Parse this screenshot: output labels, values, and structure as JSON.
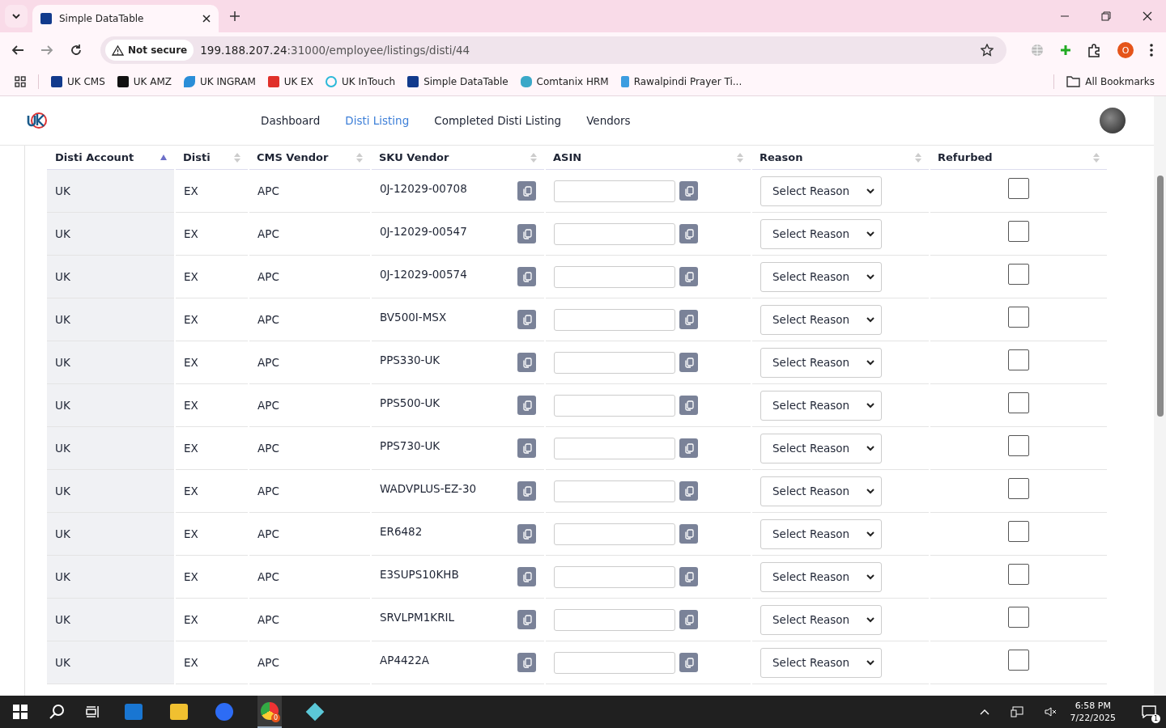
{
  "browser": {
    "tab_title": "Simple DataTable",
    "security": "Not secure",
    "url_host": "199.188.207.24",
    "url_path": ":31000/employee/listings/disti/44",
    "profile": "O",
    "bookmarks": [
      {
        "label": "UK CMS",
        "kind": "df"
      },
      {
        "label": "UK AMZ",
        "kind": "amz"
      },
      {
        "label": "UK INGRAM",
        "kind": "ingram"
      },
      {
        "label": "UK EX",
        "kind": "ex"
      },
      {
        "label": "UK InTouch",
        "kind": "intouch"
      },
      {
        "label": "Simple DataTable",
        "kind": "df"
      },
      {
        "label": "Comtanix HRM",
        "kind": "hex"
      },
      {
        "label": "Rawalpindi Prayer Ti...",
        "kind": "h"
      }
    ],
    "all_bookmarks": "All Bookmarks"
  },
  "nav": [
    {
      "label": "Dashboard",
      "selected": false
    },
    {
      "label": "Disti Listing",
      "selected": true
    },
    {
      "label": "Completed Disti Listing",
      "selected": false
    },
    {
      "label": "Vendors",
      "selected": false
    }
  ],
  "table": {
    "columns": [
      {
        "label": "Disti Account",
        "sorted": true
      },
      {
        "label": "Disti",
        "sorted": false
      },
      {
        "label": "CMS Vendor",
        "sorted": false
      },
      {
        "label": "SKU Vendor",
        "sorted": false
      },
      {
        "label": "ASIN",
        "sorted": false
      },
      {
        "label": "Reason",
        "sorted": false
      },
      {
        "label": "Refurbed",
        "sorted": false
      }
    ],
    "rows": [
      {
        "account": "UK",
        "disti": "EX",
        "cms_vendor": "APC",
        "sku_vendor": "0J-12029-00708",
        "reason": "Select Reason",
        "refurbed": false
      },
      {
        "account": "UK",
        "disti": "EX",
        "cms_vendor": "APC",
        "sku_vendor": "0J-12029-00547",
        "reason": "Select Reason",
        "refurbed": false
      },
      {
        "account": "UK",
        "disti": "EX",
        "cms_vendor": "APC",
        "sku_vendor": "0J-12029-00574",
        "reason": "Select Reason",
        "refurbed": false
      },
      {
        "account": "UK",
        "disti": "EX",
        "cms_vendor": "APC",
        "sku_vendor": "BV500I-MSX",
        "reason": "Select Reason",
        "refurbed": false
      },
      {
        "account": "UK",
        "disti": "EX",
        "cms_vendor": "APC",
        "sku_vendor": "PPS330-UK",
        "reason": "Select Reason",
        "refurbed": false
      },
      {
        "account": "UK",
        "disti": "EX",
        "cms_vendor": "APC",
        "sku_vendor": "PPS500-UK",
        "reason": "Select Reason",
        "refurbed": false
      },
      {
        "account": "UK",
        "disti": "EX",
        "cms_vendor": "APC",
        "sku_vendor": "PPS730-UK",
        "reason": "Select Reason",
        "refurbed": false
      },
      {
        "account": "UK",
        "disti": "EX",
        "cms_vendor": "APC",
        "sku_vendor": "WADVPLUS-EZ-30",
        "reason": "Select Reason",
        "refurbed": false
      },
      {
        "account": "UK",
        "disti": "EX",
        "cms_vendor": "APC",
        "sku_vendor": "ER6482",
        "reason": "Select Reason",
        "refurbed": false
      },
      {
        "account": "UK",
        "disti": "EX",
        "cms_vendor": "APC",
        "sku_vendor": "E3SUPS10KHB",
        "reason": "Select Reason",
        "refurbed": false
      },
      {
        "account": "UK",
        "disti": "EX",
        "cms_vendor": "APC",
        "sku_vendor": "SRVLPM1KRIL",
        "reason": "Select Reason",
        "refurbed": false
      },
      {
        "account": "UK",
        "disti": "EX",
        "cms_vendor": "APC",
        "sku_vendor": "AP4422A",
        "reason": "Select Reason",
        "refurbed": false
      }
    ]
  },
  "taskbar": {
    "chrome_badge": "0",
    "time": "6:58 PM",
    "date": "7/22/2025",
    "notifications": "1"
  }
}
